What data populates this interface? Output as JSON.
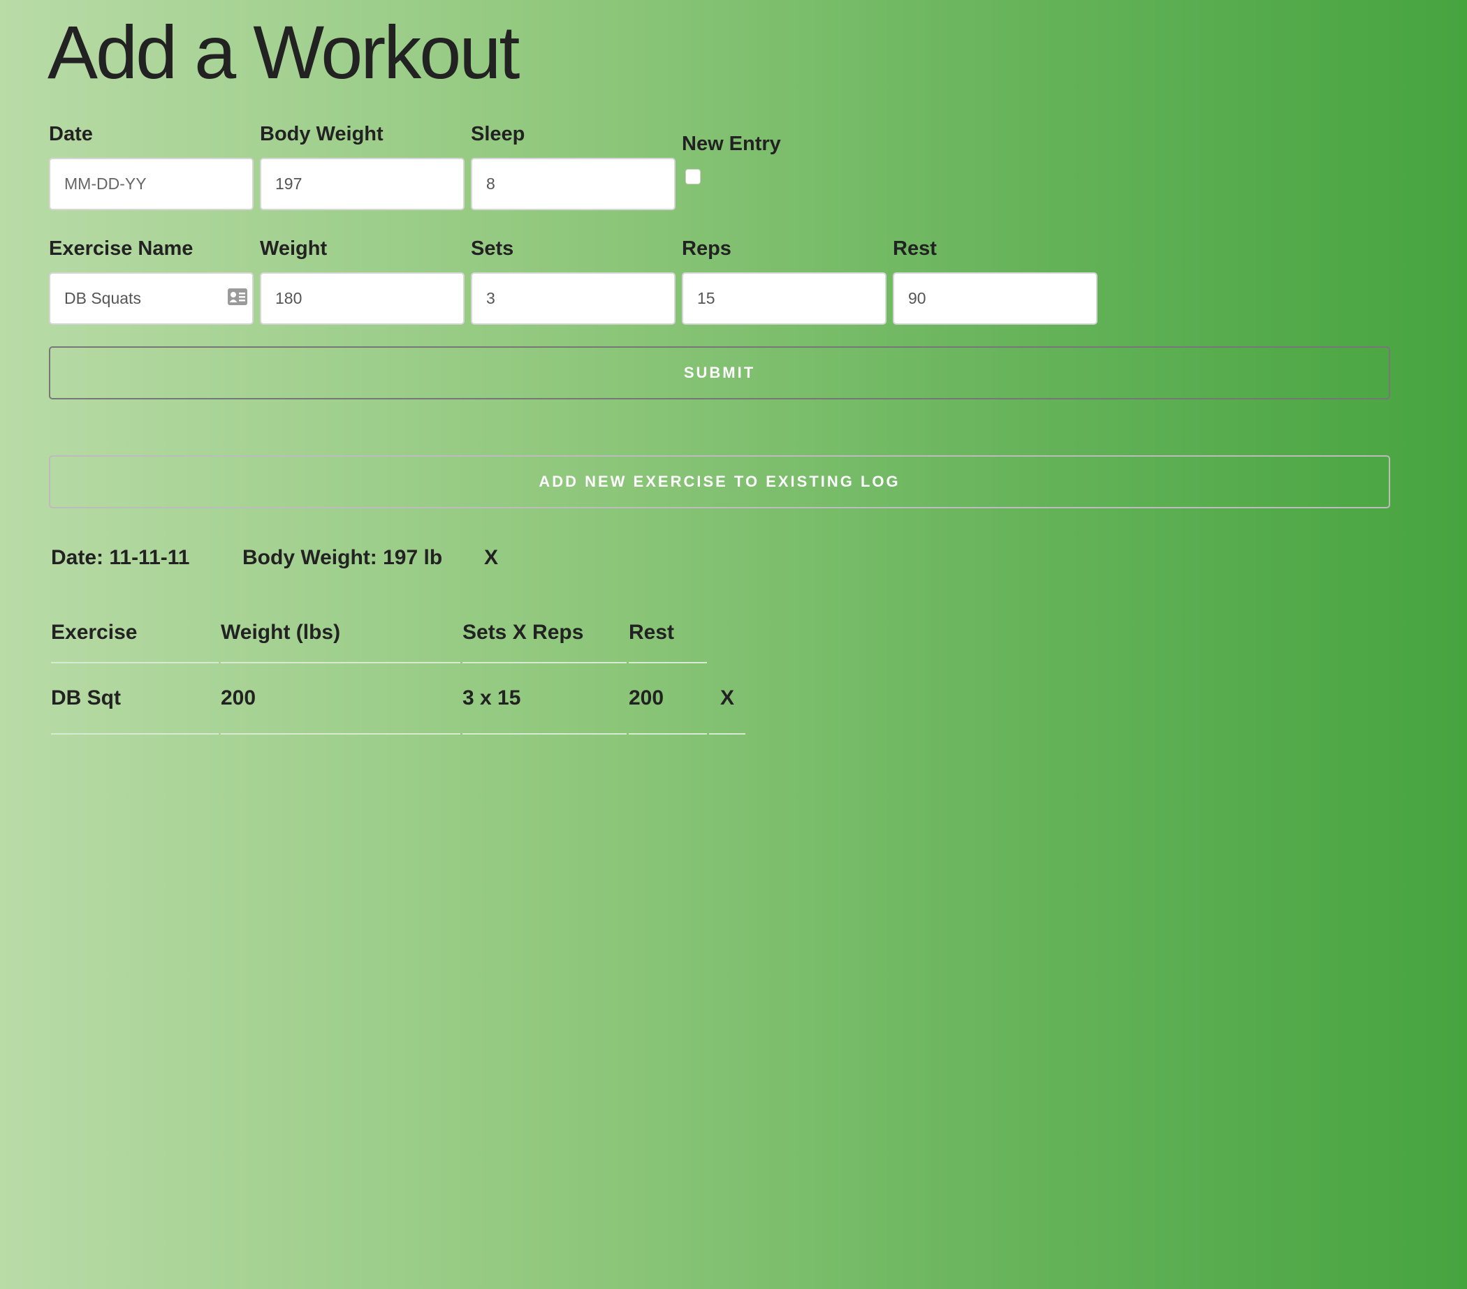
{
  "page_title": "Add a Workout",
  "form": {
    "date_label": "Date",
    "date_placeholder": "MM-DD-YY",
    "date_value": "",
    "body_weight_label": "Body Weight",
    "body_weight_value": "197",
    "sleep_label": "Sleep",
    "sleep_value": "8",
    "new_entry_label": "New Entry",
    "new_entry_checked": false,
    "exercise_name_label": "Exercise Name",
    "exercise_name_value": "DB Squats",
    "weight_label": "Weight",
    "weight_value": "180",
    "sets_label": "Sets",
    "sets_value": "3",
    "reps_label": "Reps",
    "reps_value": "15",
    "rest_label": "Rest",
    "rest_value": "90",
    "submit_label": "Submit",
    "add_existing_label": "Add new exercise to existing log",
    "contact_card_icon": "contact-card-icon"
  },
  "log": {
    "date_text": "Date: 11-11-11",
    "body_weight_text": "Body Weight: 197 lb",
    "delete_label": "X",
    "columns": [
      "Exercise",
      "Weight (lbs)",
      "Sets X Reps",
      "Rest"
    ],
    "rows": [
      {
        "exercise": "DB Sqt",
        "weight": "200",
        "sets_reps": "3 x 15",
        "rest": "200",
        "delete": "X"
      }
    ]
  }
}
